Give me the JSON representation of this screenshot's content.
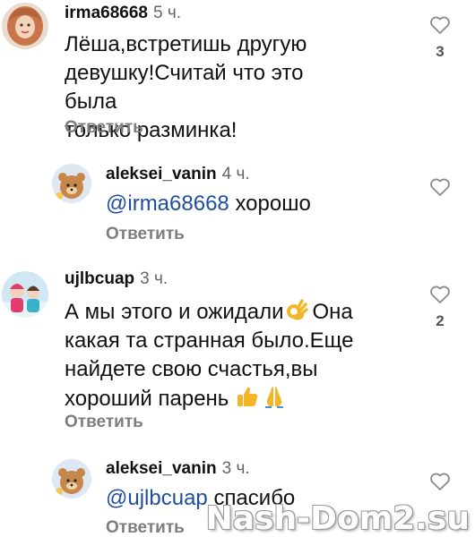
{
  "comments": [
    {
      "username": "irma68668",
      "time": "5 ч.",
      "text_lines": [
        "Лёша,встретишь другую",
        "девушку!Считай что это была",
        "только разминка!"
      ],
      "reply_label": "Ответить",
      "likes": "3",
      "avatar_icon": "woman-portrait-avatar"
    },
    {
      "username": "aleksei_vanin",
      "time": "4 ч.",
      "mention": "@irma68668",
      "text": "хорошо",
      "reply_label": "Ответить",
      "avatar_icon": "bear-avatar"
    },
    {
      "username": "ujlbcuap",
      "time": "3 ч.",
      "text_line1": "А мы этого и ожидали",
      "text_line1b": "Она",
      "text_line2": "какая та странная было.Еще",
      "text_line3": "найдете свою счастья,вы",
      "text_line4": "хороший парень",
      "reply_label": "Ответить",
      "likes": "2",
      "emojis": [
        "ok-hand-emoji",
        "thumbs-up-emoji",
        "praying-hands-emoji"
      ],
      "avatar_icon": "children-photo-avatar"
    },
    {
      "username": "aleksei_vanin",
      "time": "3 ч.",
      "mention": "@ujlbcuap",
      "text": "спасибо",
      "reply_label": "Ответить",
      "avatar_icon": "bear-avatar"
    }
  ],
  "watermark": "Nash-Dom2.su",
  "colors": {
    "mention": "#1f4e9e",
    "secondary": "#7d7d7d"
  }
}
